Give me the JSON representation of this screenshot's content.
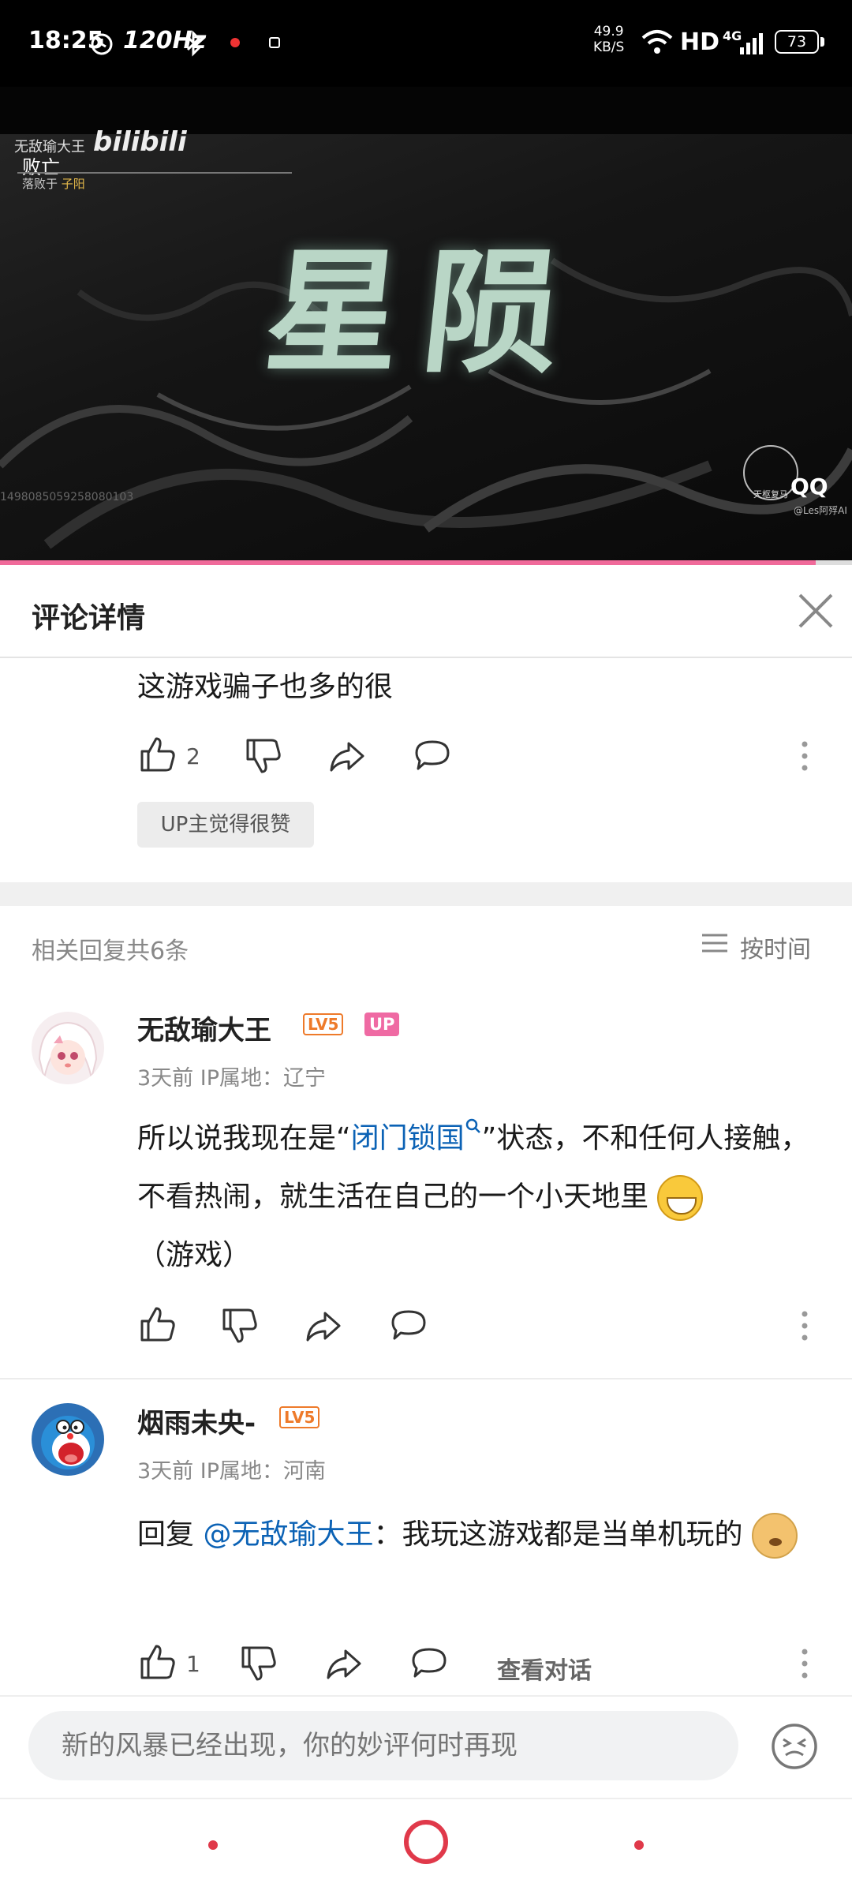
{
  "status_bar": {
    "time": "18:25",
    "refresh": "120Hz",
    "net_speed": "49.9",
    "net_unit": "KB/S",
    "hd": "HD",
    "network": "4G",
    "battery": "73"
  },
  "video": {
    "overlay_user": "无敌瑜大王",
    "overlay_logo": "bilibili",
    "overlay_status": "败亡",
    "overlay_defeat_prefix": "落败于",
    "overlay_defeat_by": "子阳",
    "title_art": "星陨",
    "video_id": "1498085059258080103",
    "watermark_stamp": "天枢复马",
    "watermark_qq": "QQ",
    "watermark_credit": "@Les阿殍AI",
    "progress": 0.957
  },
  "header": {
    "title": "评论详情"
  },
  "root_comment": {
    "text": "这游戏骗子也多的很",
    "likes": "2",
    "up_liked": "UP主觉得很赞"
  },
  "replies_header": {
    "count_label": "相关回复共6条",
    "sort_label": "按时间"
  },
  "replies": [
    {
      "name": "无敌瑜大王",
      "level": "LV5",
      "up_badge": "UP",
      "meta": "3天前 IP属地：辽宁",
      "text_before": "所以说我现在是“",
      "link": "闭门锁国",
      "text_after": "”状态，不和任何人接触，不看热闹，就生活在自己的一个小天地里",
      "text_tail": "（游戏）"
    },
    {
      "name": "烟雨未央-",
      "level": "LV5",
      "meta": "3天前 IP属地：河南",
      "text_prefix": "回复 ",
      "mention": "@无敌瑜大王",
      "text_after": "：我玩这游戏都是当单机玩的",
      "likes": "1",
      "view_convo": "查看对话"
    }
  ],
  "composer": {
    "placeholder": "新的风暴已经出现，你的妙评何时再现"
  },
  "colors": {
    "accent_pink": "#ef6aa3",
    "link_blue": "#0b62b5",
    "level_orange": "#ee7a2a",
    "nav_red": "#e0394a"
  }
}
